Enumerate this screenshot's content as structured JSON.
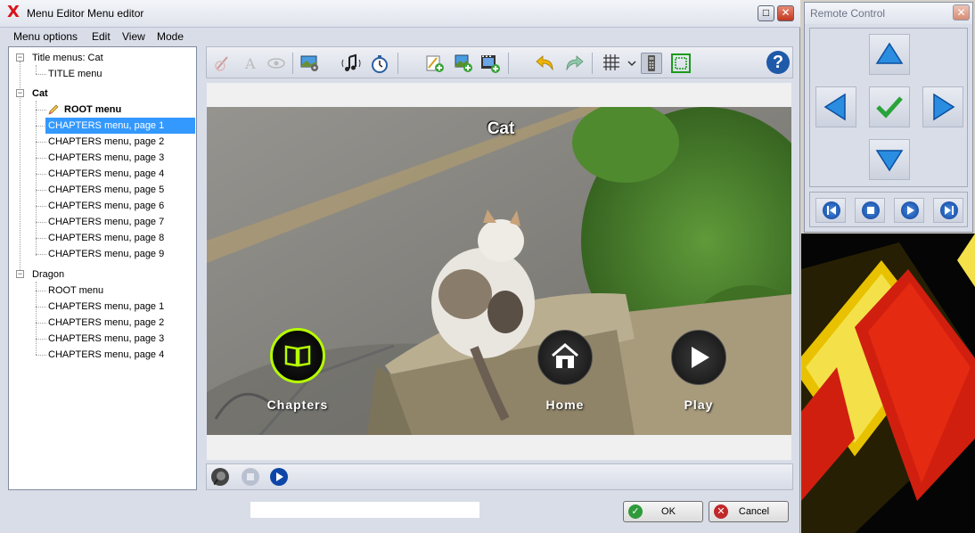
{
  "window": {
    "title": "Menu Editor Menu editor"
  },
  "menubar": [
    "Menu options",
    "Edit",
    "View",
    "Mode"
  ],
  "tree": {
    "groups": [
      {
        "label": "Title menus: Cat",
        "items": [
          "TITLE menu"
        ]
      },
      {
        "label": "Cat",
        "items": [
          "ROOT menu",
          "CHAPTERS menu, page 1",
          "CHAPTERS menu, page 2",
          "CHAPTERS menu, page 3",
          "CHAPTERS menu, page 4",
          "CHAPTERS menu, page 5",
          "CHAPTERS menu, page 6",
          "CHAPTERS menu, page 7",
          "CHAPTERS menu, page 8",
          "CHAPTERS menu, page 9"
        ]
      },
      {
        "label": "Dragon",
        "items": [
          "ROOT menu",
          "CHAPTERS menu, page 1",
          "CHAPTERS menu, page 2",
          "CHAPTERS menu, page 3",
          "CHAPTERS menu, page 4"
        ]
      }
    ],
    "selected": "CHAPTERS menu, page 1"
  },
  "preview": {
    "menu_title": "Cat",
    "buttons": [
      {
        "label": "Chapters",
        "icon": "book-icon",
        "active": true
      },
      {
        "label": "Home",
        "icon": "house-icon",
        "active": false
      },
      {
        "label": "Play",
        "icon": "play-icon",
        "active": false
      }
    ]
  },
  "toolbar": {
    "help_label": "?"
  },
  "dialog": {
    "ok_label": "OK",
    "cancel_label": "Cancel"
  },
  "remote": {
    "title": "Remote Control"
  },
  "colors": {
    "selection": "#3399ff",
    "active_button_ring": "#b6ff00",
    "accent_blue": "#1e5aa8"
  }
}
